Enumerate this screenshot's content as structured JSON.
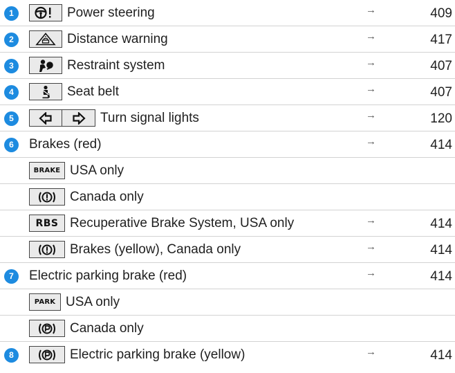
{
  "rows": [
    {
      "num": "1",
      "label": "Power steering",
      "arrow": "→",
      "page": "409",
      "icons": [
        "steering-warning-icon"
      ]
    },
    {
      "num": "2",
      "label": "Distance warning",
      "arrow": "→",
      "page": "417",
      "icons": [
        "distance-warning-icon"
      ]
    },
    {
      "num": "3",
      "label": "Restraint system",
      "arrow": "→",
      "page": "407",
      "icons": [
        "restraint-system-icon"
      ]
    },
    {
      "num": "4",
      "label": "Seat belt",
      "arrow": "→",
      "page": "407",
      "icons": [
        "seat-belt-icon"
      ]
    },
    {
      "num": "5",
      "label": "Turn signal lights",
      "arrow": "→",
      "page": "120",
      "icons": [
        "turn-signal-left-icon",
        "turn-signal-right-icon"
      ]
    },
    {
      "num": "6",
      "label": "Brakes (red)",
      "arrow": "→",
      "page": "414",
      "icons": []
    },
    {
      "label": "USA only",
      "icons": [
        "brake-text-icon"
      ],
      "icon_text": "BRAKE"
    },
    {
      "label": "Canada only",
      "icons": [
        "brake-circle-icon"
      ]
    },
    {
      "label": "Recuperative Brake System, USA only",
      "arrow": "→",
      "page": "414",
      "icons": [
        "rbs-text-icon"
      ],
      "icon_text": "RBS"
    },
    {
      "label": "Brakes (yellow), Canada only",
      "arrow": "→",
      "page": "414",
      "icons": [
        "brake-circle-icon"
      ]
    },
    {
      "num": "7",
      "label": "Electric parking brake (red)",
      "arrow": "→",
      "page": "414",
      "icons": []
    },
    {
      "label": "USA only",
      "icons": [
        "park-text-icon"
      ],
      "icon_text": "PARK"
    },
    {
      "label": "Canada only",
      "icons": [
        "parking-brake-circle-icon"
      ]
    },
    {
      "num": "8",
      "label": "Electric parking brake (yellow)",
      "arrow": "→",
      "page": "414",
      "icons": [
        "parking-brake-circle-icon"
      ]
    }
  ],
  "colors": {
    "number_badge": "#1d8be0",
    "icon_box_bg": "#eaeaea",
    "divider": "#d2d2d2"
  }
}
